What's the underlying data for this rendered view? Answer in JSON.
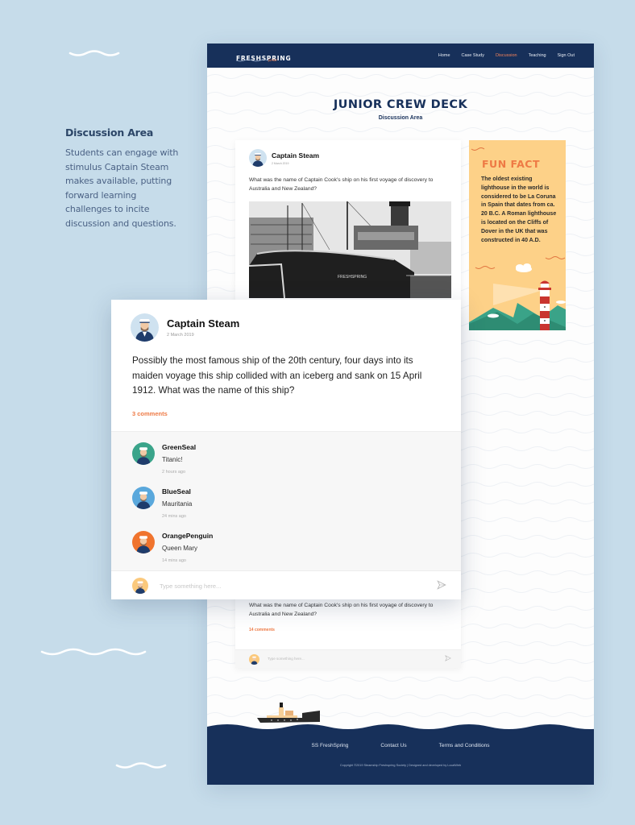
{
  "caption": {
    "title": "Discussion Area",
    "body": "Students can engage with stimulus Captain Steam makes available, putting forward learning challenges to incite discussion and questions."
  },
  "site": {
    "logo": {
      "main": "FRESHSPRING",
      "sub": "junior"
    },
    "nav": [
      {
        "label": "Home",
        "active": false
      },
      {
        "label": "Case Study",
        "active": false
      },
      {
        "label": "Discussion",
        "active": true
      },
      {
        "label": "Teaching",
        "active": false
      },
      {
        "label": "Sign Out",
        "active": false
      }
    ],
    "page_title": "JUNIOR CREW DECK",
    "page_subtitle": "Discussion Area",
    "colors": {
      "navy": "#17305a",
      "accent": "#ee7a45",
      "funfact_bg": "#fdd188",
      "page_bg": "#c6dcea"
    }
  },
  "background_post": {
    "author": "Captain Steam",
    "date": "2 March 2019",
    "question": "What was the name of Captain Cook's ship on his first voyage of discovery to Australia and New Zealand?",
    "photo_alt": "Black and white photo of steamship FRESHSPRING docked",
    "ship_name_on_hull": "FRESHSPRING"
  },
  "second_post": {
    "question": "What was the name of Captain Cook's ship on his first voyage of discovery to Australia and New Zealand?",
    "comments_label": "14 comments",
    "input_placeholder": "Type something here..."
  },
  "fun_fact": {
    "title": "FUN FACT",
    "text": "The oldest existing lighthouse in the world is considered to be La Coruna in Spain that dates from ca. 20 B.C. A Roman lighthouse is located on the Cliffs of Dover in the UK that was constructed in 40 A.D."
  },
  "popup_post": {
    "author": "Captain Steam",
    "date": "2 March 2019",
    "question": "Possibly the most famous ship of the 20th century, four days into its maiden voyage this ship collided with an iceberg and sank on 15 April 1912. What was the name of this ship?",
    "comments_label": "3 comments",
    "comments": [
      {
        "name": "GreenSeal",
        "text": "Titanic!",
        "time": "2 hours ago",
        "avatar_color": "#3aa48a"
      },
      {
        "name": "BlueSeal",
        "text": "Mauritania",
        "time": "24 mins ago",
        "avatar_color": "#5aa8dc"
      },
      {
        "name": "OrangePenguin",
        "text": "Queen Mary",
        "time": "14 mins ago",
        "avatar_color": "#f0742e"
      }
    ],
    "input_placeholder": "Type something here..."
  },
  "footer": {
    "links": [
      "SS FreshSpring",
      "Contact Us",
      "Terms and Conditions"
    ],
    "copyright": "Copyright ©2019 Steamship Freshspring Society | Designed and developed by LocalWeb"
  }
}
